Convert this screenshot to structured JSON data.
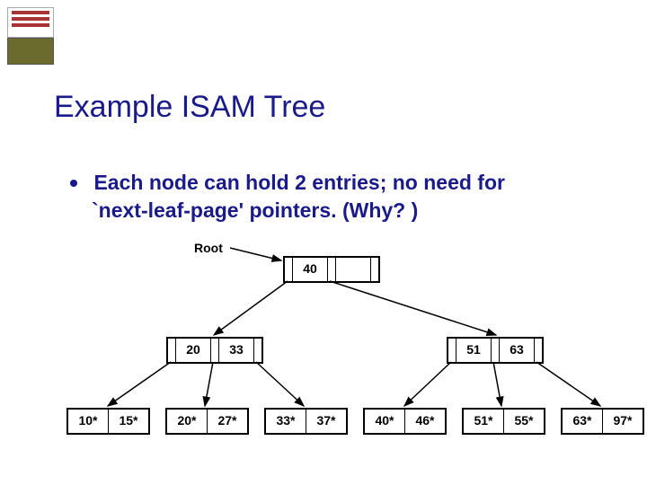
{
  "title": "Example ISAM Tree",
  "bullet": {
    "line1": "Each node can hold 2 entries; no need for",
    "line2": "`next-leaf-page' pointers.  (Why? )"
  },
  "rootLabel": "Root",
  "root": {
    "keys": [
      "40",
      ""
    ]
  },
  "index": {
    "left": {
      "keys": [
        "20",
        "33"
      ]
    },
    "right": {
      "keys": [
        "51",
        "63"
      ]
    }
  },
  "leaves": [
    {
      "cells": [
        "10*",
        "15*"
      ]
    },
    {
      "cells": [
        "20*",
        "27*"
      ]
    },
    {
      "cells": [
        "33*",
        "37*"
      ]
    },
    {
      "cells": [
        "40*",
        "46*"
      ]
    },
    {
      "cells": [
        "51*",
        "55*"
      ]
    },
    {
      "cells": [
        "63*",
        "97*"
      ]
    }
  ]
}
